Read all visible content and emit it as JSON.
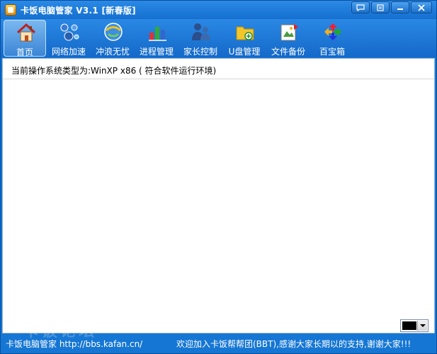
{
  "window": {
    "title": "卡饭电脑管家 V3.1 [新春版]"
  },
  "title_buttons": [
    {
      "name": "feedback",
      "icon": "chat-bubble-icon"
    },
    {
      "name": "menu",
      "icon": "menu-icon"
    },
    {
      "name": "minimize",
      "icon": "minimize-icon"
    },
    {
      "name": "close",
      "icon": "close-icon"
    }
  ],
  "toolbar": {
    "items": [
      {
        "label": "首页",
        "icon": "home-icon",
        "active": true
      },
      {
        "label": "网络加速",
        "icon": "network-icon"
      },
      {
        "label": "冲浪无忧",
        "icon": "browser-icon"
      },
      {
        "label": "进程管理",
        "icon": "process-icon"
      },
      {
        "label": "家长控制",
        "icon": "parental-icon"
      },
      {
        "label": "U盘管理",
        "icon": "usb-folder-icon"
      },
      {
        "label": "文件备份",
        "icon": "backup-icon"
      },
      {
        "label": "百宝箱",
        "icon": "toolbox-icon"
      }
    ]
  },
  "content": {
    "system_info": "当前操作系统类型为:WinXP x86 ( 符合软件运行环境)"
  },
  "watermark": "卡饭论坛",
  "color_picker": {
    "value": "#000000"
  },
  "statusbar": {
    "left": "卡饭电脑管家  http://bbs.kafan.cn/",
    "right": "欢迎加入卡饭帮帮团(BBT),感谢大家长期以的支持,谢谢大家!!!"
  },
  "colors": {
    "accent": "#1576d4",
    "title_text": "#ffffff",
    "content_bg": "#ffffff"
  }
}
